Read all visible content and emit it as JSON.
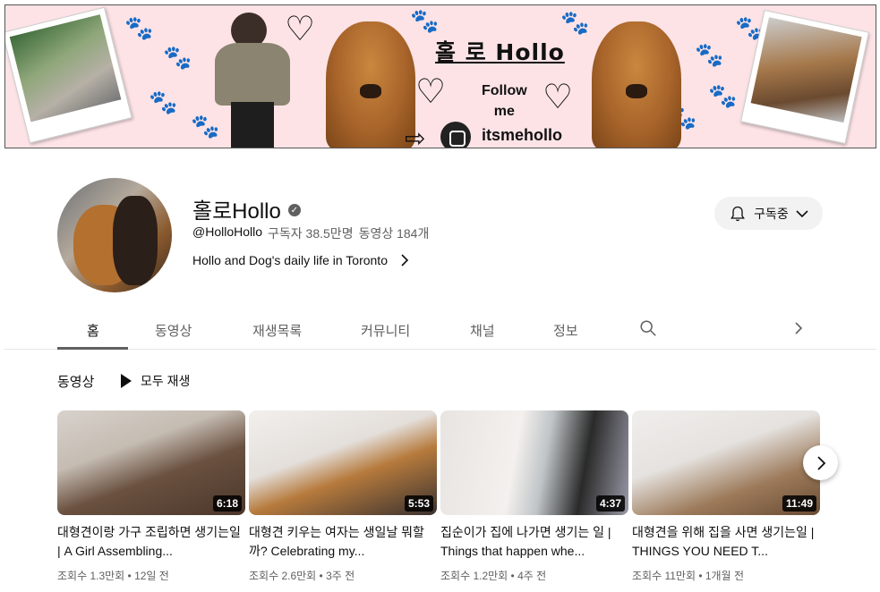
{
  "banner": {
    "title": "홀 로 Hollo",
    "follow_line1": "Follow",
    "follow_line2": "me",
    "handle": "itsmehollo"
  },
  "channel": {
    "name": "홀로Hollo",
    "handle": "@HolloHollo",
    "subscribers": "구독자 38.5만명",
    "video_count": "동영상 184개",
    "description": "Hollo and Dog's daily life in Toronto",
    "subscribe_label": "구독중"
  },
  "tabs": [
    {
      "label": "홈"
    },
    {
      "label": "동영상"
    },
    {
      "label": "재생목록"
    },
    {
      "label": "커뮤니티"
    },
    {
      "label": "채널"
    },
    {
      "label": "정보"
    }
  ],
  "section": {
    "title": "동영상",
    "play_all": "모두 재생"
  },
  "videos": [
    {
      "title": "대형견이랑 가구 조립하면 생기는일 | A Girl Assembling...",
      "duration": "6:18",
      "meta": "조회수 1.3만회 • 12일 전"
    },
    {
      "title": "대형견 키우는 여자는 생일날 뭐할까? Celebrating my...",
      "duration": "5:53",
      "meta": "조회수 2.6만회 • 3주 전"
    },
    {
      "title": "집순이가 집에 나가면 생기는 일 | Things that happen whe...",
      "duration": "4:37",
      "meta": "조회수 1.2만회 • 4주 전"
    },
    {
      "title": "대형견을 위해 집을 사면 생기는일 | THINGS YOU NEED T...",
      "duration": "11:49",
      "meta": "조회수 11만회 • 1개월 전"
    }
  ],
  "colors": {
    "banner_bg": "#fde3e6",
    "muted_text": "#606060",
    "primary_text": "#0f0f0f",
    "button_bg": "#f2f2f2"
  }
}
